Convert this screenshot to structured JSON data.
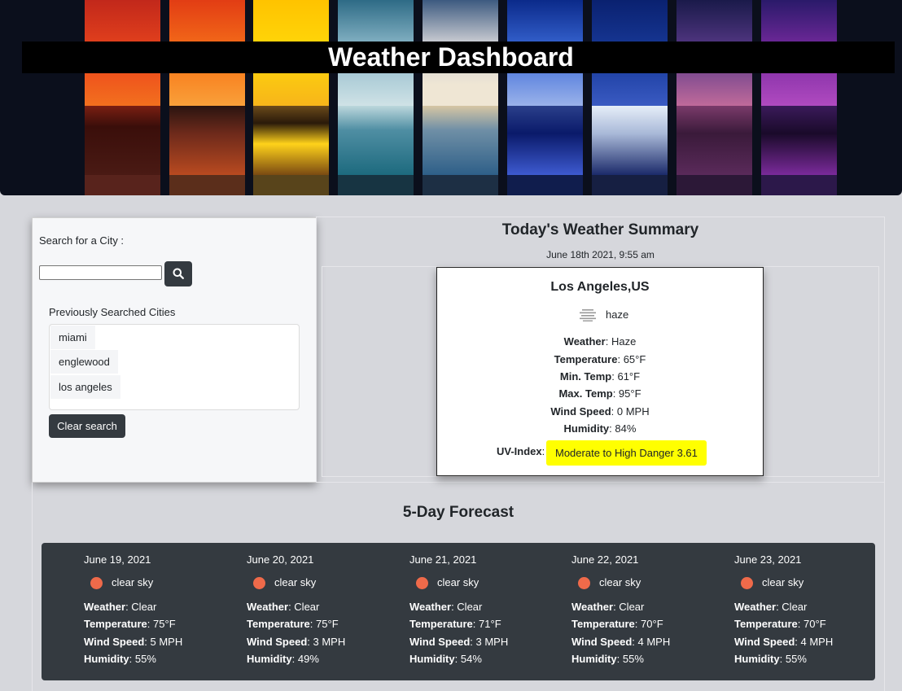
{
  "header": {
    "title": "Weather Dashboard"
  },
  "search": {
    "label": "Search for a City :",
    "input_value": "",
    "button_icon": "search-icon",
    "history_label": "Previously Searched Cities",
    "history": [
      "miami",
      "englewood",
      "los angeles"
    ],
    "clear_label": "Clear search"
  },
  "today": {
    "heading": "Today's Weather Summary",
    "datetime": "June 18th 2021, 9:55 am",
    "city": "Los Angeles,US",
    "icon": "haze-icon",
    "description": "haze",
    "weather_label": "Weather",
    "weather": "Haze",
    "temp_label": "Temperature",
    "temp": "65°F",
    "min_label": "Min. Temp",
    "min": "61°F",
    "max_label": "Max. Temp",
    "max": "95°F",
    "wind_label": "Wind Speed",
    "wind": "0 MPH",
    "humidity_label": "Humidity",
    "humidity": "84%",
    "uv_label": "UV-Index",
    "uv_text": "Moderate to High Danger 3.61",
    "uv_color": "#ffff00"
  },
  "forecast": {
    "heading": "5-Day Forecast",
    "labels": {
      "weather": "Weather",
      "temp": "Temperature",
      "wind": "Wind Speed",
      "humidity": "Humidity"
    },
    "days": [
      {
        "date": "June 19, 2021",
        "icon": "sun-icon",
        "desc": "clear sky",
        "weather": "Clear",
        "temp": "75°F",
        "wind": "5 MPH",
        "humidity": "55%"
      },
      {
        "date": "June 20, 2021",
        "icon": "sun-icon",
        "desc": "clear sky",
        "weather": "Clear",
        "temp": "75°F",
        "wind": "3 MPH",
        "humidity": "49%"
      },
      {
        "date": "June 21, 2021",
        "icon": "sun-icon",
        "desc": "clear sky",
        "weather": "Clear",
        "temp": "71°F",
        "wind": "3 MPH",
        "humidity": "54%"
      },
      {
        "date": "June 22, 2021",
        "icon": "sun-icon",
        "desc": "clear sky",
        "weather": "Clear",
        "temp": "70°F",
        "wind": "4 MPH",
        "humidity": "55%"
      },
      {
        "date": "June 23, 2021",
        "icon": "sun-icon",
        "desc": "clear sky",
        "weather": "Clear",
        "temp": "70°F",
        "wind": "4 MPH",
        "humidity": "55%"
      }
    ]
  },
  "colors": {
    "page_bg": "#d6d7dc",
    "dark": "#343a40",
    "sun": "#ef6a4a",
    "uv_highlight": "#ffff00"
  }
}
